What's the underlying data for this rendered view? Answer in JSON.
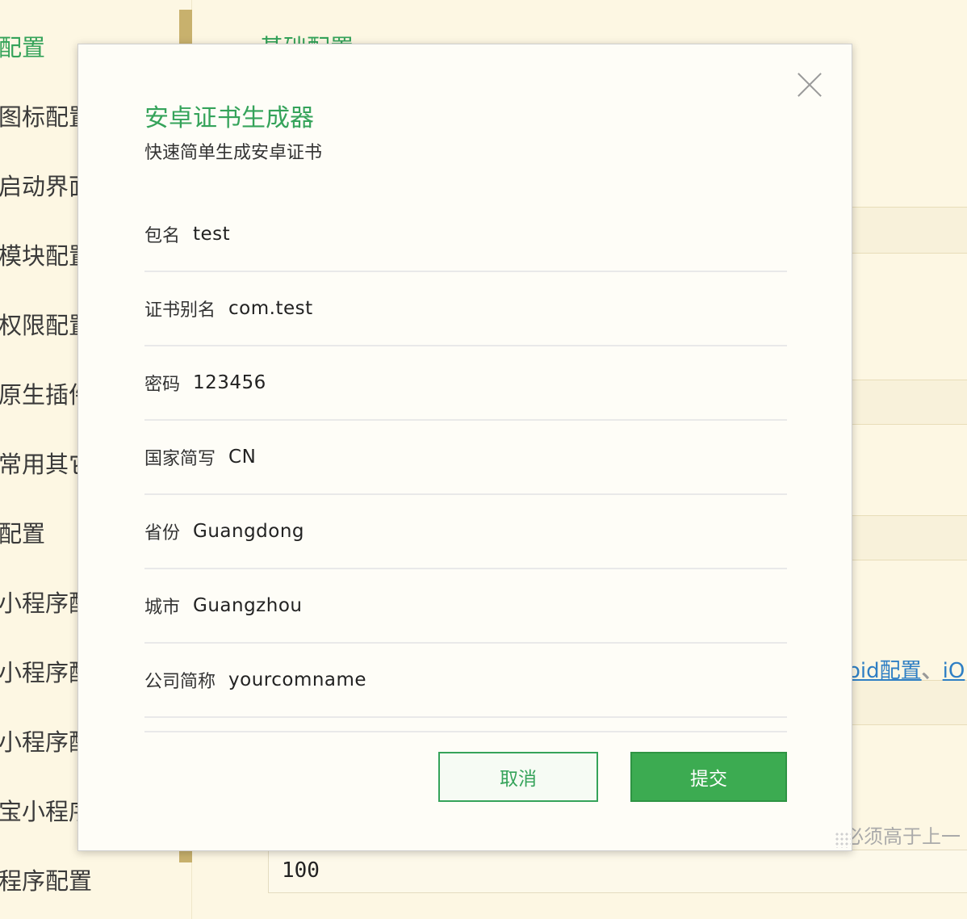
{
  "sidebar": {
    "items": [
      {
        "label": "配置",
        "active": true
      },
      {
        "label": "图标配置"
      },
      {
        "label": "启动界面"
      },
      {
        "label": "模块配置"
      },
      {
        "label": "权限配置"
      },
      {
        "label": "原生插件"
      },
      {
        "label": "常用其它"
      },
      {
        "label": "配置"
      },
      {
        "label": "小程序配"
      },
      {
        "label": "小程序配"
      },
      {
        "label": "小程序配"
      },
      {
        "label": "宝小程序"
      },
      {
        "label": "程序配置"
      }
    ]
  },
  "main": {
    "section_title": "基础配置",
    "link_text_1": "oid配置",
    "link_sep": "、",
    "link_text_2": "iO",
    "hint": "必须高于上一",
    "bottom_input_value": "100"
  },
  "modal": {
    "title": "安卓证书生成器",
    "subtitle": "快速简单生成安卓证书",
    "fields": [
      {
        "label": "包名",
        "value": "test"
      },
      {
        "label": "证书别名",
        "value": "com.test"
      },
      {
        "label": "密码",
        "value": "123456"
      },
      {
        "label": "国家简写",
        "value": "CN"
      },
      {
        "label": "省份",
        "value": "Guangdong"
      },
      {
        "label": "城市",
        "value": "Guangzhou"
      },
      {
        "label": "公司简称",
        "value": "yourcomname"
      }
    ],
    "cancel_label": "取消",
    "submit_label": "提交"
  },
  "colors": {
    "accent": "#35a35a",
    "background": "#fdf7e3",
    "link": "#2f7fc4"
  }
}
